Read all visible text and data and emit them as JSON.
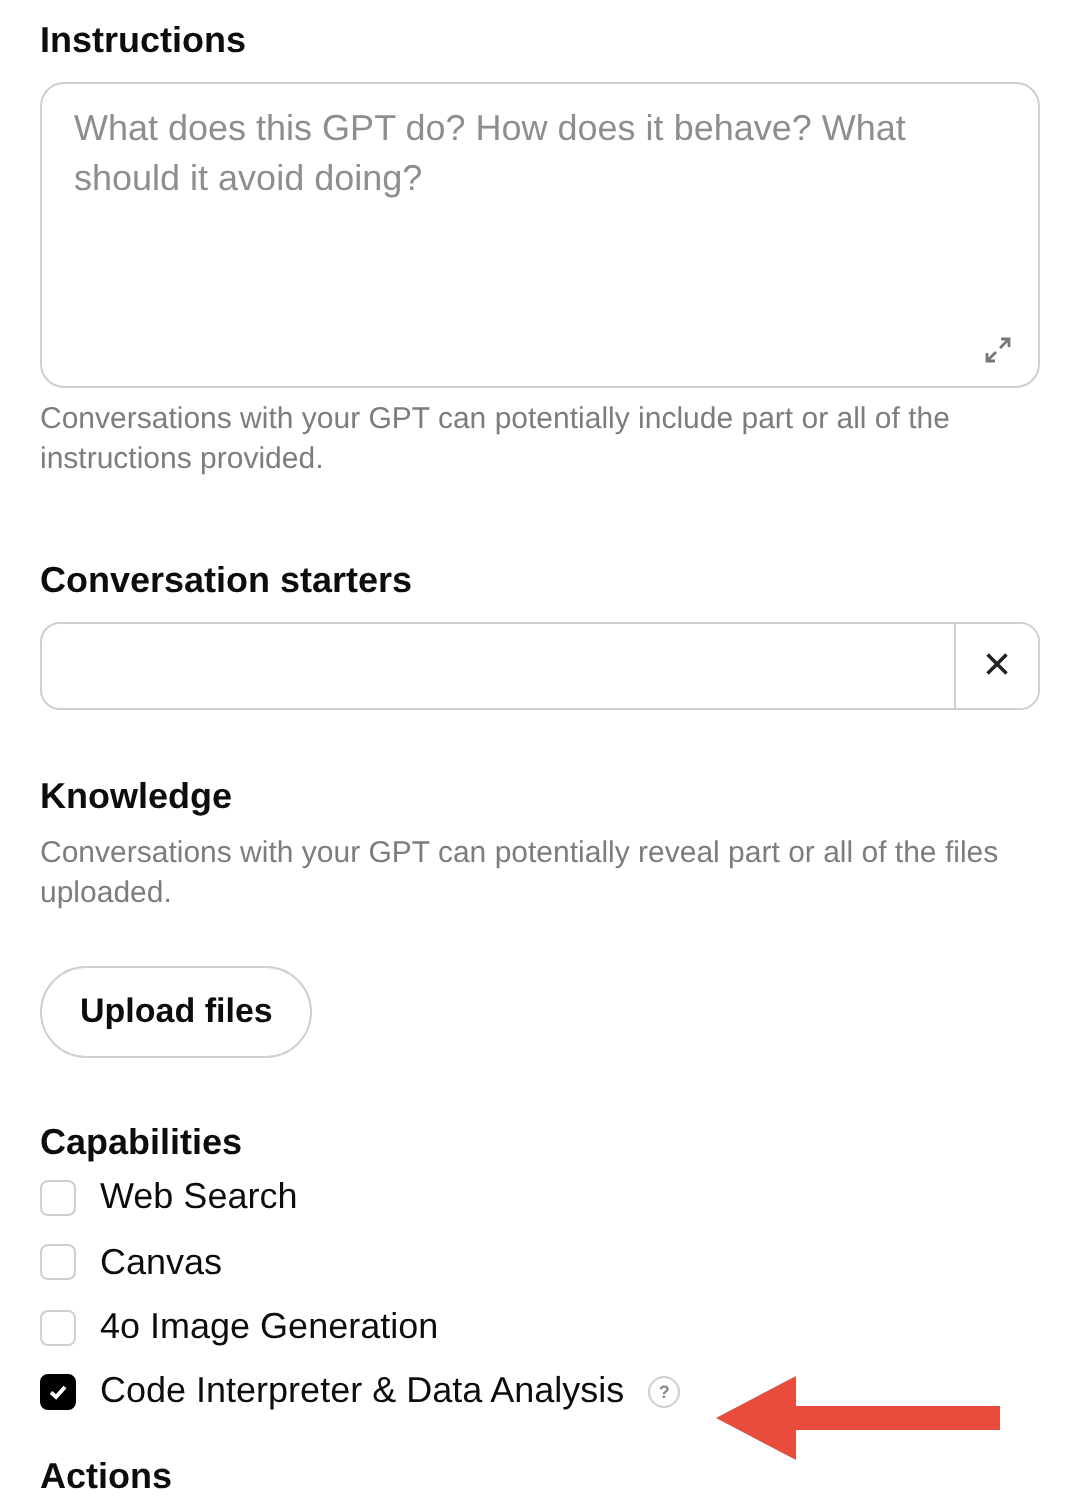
{
  "instructions": {
    "heading": "Instructions",
    "placeholder": "What does this GPT do? How does it behave? What should it avoid doing?",
    "hint": "Conversations with your GPT can potentially include part or all of the instructions provided."
  },
  "conversation_starters": {
    "heading": "Conversation starters",
    "clear_button": "×"
  },
  "knowledge": {
    "heading": "Knowledge",
    "hint": "Conversations with your GPT can potentially reveal part or all of the files uploaded.",
    "upload_button": "Upload files"
  },
  "capabilities": {
    "heading": "Capabilities",
    "items": [
      {
        "label": "Web Search",
        "checked": false
      },
      {
        "label": "Canvas",
        "checked": false
      },
      {
        "label": "4o Image Generation",
        "checked": false
      },
      {
        "label": "Code Interpreter & Data Analysis",
        "checked": true,
        "help_icon": "?"
      }
    ]
  },
  "actions": {
    "heading": "Actions"
  }
}
